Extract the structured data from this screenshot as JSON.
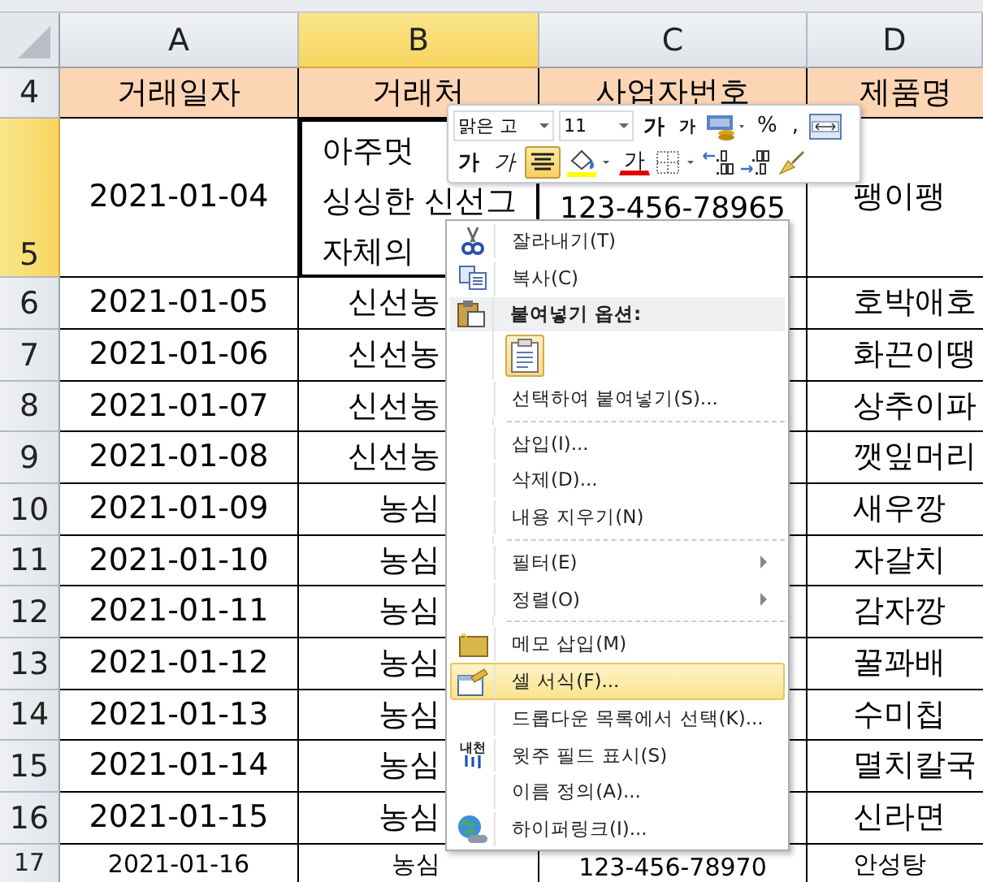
{
  "column_headers": [
    {
      "label": "A",
      "selected": false
    },
    {
      "label": "B",
      "selected": true
    },
    {
      "label": "C",
      "selected": false
    },
    {
      "label": "D",
      "selected": false
    }
  ],
  "rows": [
    {
      "number": "4",
      "selected": false,
      "kind": "heading",
      "cells": {
        "A": "거래일자",
        "B": "거래처",
        "C": "사업자번호",
        "D": "제품명"
      }
    },
    {
      "number": "5",
      "selected": true,
      "kind": "tall",
      "cells": {
        "A": "2021-01-04",
        "B": "아주멋\n싱싱한 신선그\n자체의",
        "C": "123-456-78965",
        "D": "팽이팽"
      }
    },
    {
      "number": "6",
      "selected": false,
      "kind": "data",
      "cells": {
        "A": "2021-01-05",
        "B": "신선농",
        "D": "호박애호"
      }
    },
    {
      "number": "7",
      "selected": false,
      "kind": "data",
      "cells": {
        "A": "2021-01-06",
        "B": "신선농",
        "D": "화끈이땡"
      }
    },
    {
      "number": "8",
      "selected": false,
      "kind": "data",
      "cells": {
        "A": "2021-01-07",
        "B": "신선농",
        "D": "상추이파"
      }
    },
    {
      "number": "9",
      "selected": false,
      "kind": "data",
      "cells": {
        "A": "2021-01-08",
        "B": "신선농",
        "D": "깻잎머리"
      }
    },
    {
      "number": "10",
      "selected": false,
      "kind": "data",
      "cells": {
        "A": "2021-01-09",
        "B": "농심",
        "D": "새우깡"
      }
    },
    {
      "number": "11",
      "selected": false,
      "kind": "data",
      "cells": {
        "A": "2021-01-10",
        "B": "농심",
        "D": "자갈치"
      }
    },
    {
      "number": "12",
      "selected": false,
      "kind": "data",
      "cells": {
        "A": "2021-01-11",
        "B": "농심",
        "D": "감자깡"
      }
    },
    {
      "number": "13",
      "selected": false,
      "kind": "data",
      "cells": {
        "A": "2021-01-12",
        "B": "농심",
        "D": "꿀꽈배"
      }
    },
    {
      "number": "14",
      "selected": false,
      "kind": "data",
      "cells": {
        "A": "2021-01-13",
        "B": "농심",
        "D": "수미칩"
      }
    },
    {
      "number": "15",
      "selected": false,
      "kind": "data",
      "cells": {
        "A": "2021-01-14",
        "B": "농심",
        "D": "멸치칼국"
      }
    },
    {
      "number": "16",
      "selected": false,
      "kind": "data",
      "cells": {
        "A": "2021-01-15",
        "B": "농심",
        "D": "신라면"
      }
    },
    {
      "number": "17",
      "selected": false,
      "kind": "last",
      "cells": {
        "A": "2021-01-16",
        "B": "농심",
        "C": "123-456-78970",
        "D": "안성탕"
      }
    }
  ],
  "mini_toolbar": {
    "tools": [
      {
        "kind": "font",
        "text": "맑은 고"
      },
      {
        "kind": "size",
        "text": "11"
      },
      {
        "kind": "grow",
        "text": "가"
      },
      {
        "kind": "shrink",
        "text": "가"
      },
      {
        "kind": "accounting"
      },
      {
        "kind": "percent",
        "text": "%"
      },
      {
        "kind": "comma",
        "text": ","
      },
      {
        "kind": "merge"
      },
      {
        "kind": "bold",
        "text": "가",
        "on": false
      },
      {
        "kind": "italic",
        "text": "가",
        "on": false
      },
      {
        "kind": "center",
        "on": true
      },
      {
        "kind": "fill"
      },
      {
        "kind": "font-color",
        "text": "가"
      },
      {
        "kind": "borders"
      },
      {
        "kind": "inc-decimal"
      },
      {
        "kind": "dec-decimal"
      },
      {
        "kind": "painter"
      }
    ]
  },
  "context_menu": [
    {
      "kind": "item",
      "label": "잘라내기(T)",
      "selected": false
    },
    {
      "kind": "item",
      "label": "복사(C)",
      "selected": false
    },
    {
      "kind": "header",
      "label": "붙여넣기 옵션:"
    },
    {
      "kind": "paste"
    },
    {
      "kind": "item",
      "label": "선택하여 붙여넣기(S)...",
      "selected": false
    },
    {
      "kind": "separator"
    },
    {
      "kind": "item",
      "label": "삽입(I)...",
      "selected": false
    },
    {
      "kind": "item",
      "label": "삭제(D)...",
      "selected": false
    },
    {
      "kind": "item",
      "label": "내용 지우기(N)",
      "selected": false
    },
    {
      "kind": "separator"
    },
    {
      "kind": "item",
      "label": "필터(E)",
      "selected": false,
      "submenu": true
    },
    {
      "kind": "item",
      "label": "정렬(O)",
      "selected": false,
      "submenu": true
    },
    {
      "kind": "separator"
    },
    {
      "kind": "item",
      "label": "메모 삽입(M)",
      "selected": false
    },
    {
      "kind": "item",
      "label": "셀 서식(F)...",
      "selected": true
    },
    {
      "kind": "item",
      "label": "드롭다운 목록에서 선택(K)...",
      "selected": false
    },
    {
      "kind": "item",
      "label": "윗주 필드 표시(S)",
      "selected": false,
      "icon_text": "내천"
    },
    {
      "kind": "item",
      "label": "이름 정의(A)...",
      "selected": false
    },
    {
      "kind": "item",
      "label": "하이퍼링크(I)...",
      "selected": false
    }
  ]
}
